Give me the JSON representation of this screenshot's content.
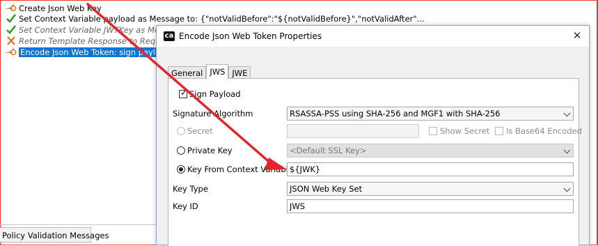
{
  "policy_tree": {
    "items": [
      {
        "label": "Create Json Web Key",
        "icon": "json-web-key-icon",
        "state": "normal"
      },
      {
        "label": "Set Context Variable payload as Message to: {\"notValidBefore\":\"${notValidBefore}\",\"notValidAfter\"...",
        "icon": "green-check-icon",
        "state": "normal"
      },
      {
        "label": "Set Context Variable JWTKey as Message",
        "icon": "green-check-icon",
        "state": "disabled"
      },
      {
        "label": "Return Template Response to Requestor",
        "icon": "red-x-icon",
        "state": "disabled"
      },
      {
        "label": "Encode Json Web Token: sign payload",
        "icon": "json-web-token-icon",
        "state": "selected"
      }
    ]
  },
  "bottom_tab": {
    "label": "Policy Validation Messages"
  },
  "dialog": {
    "title": "Encode Json Web Token Properties",
    "logo_text": "ca",
    "close_glyph": "✕",
    "tabs": [
      {
        "label": "General",
        "active": false
      },
      {
        "label": "JWS",
        "active": true
      },
      {
        "label": "JWE",
        "active": false
      }
    ],
    "sign_payload": {
      "label": "Sign Payload",
      "checked": true
    },
    "signature_algorithm": {
      "label": "Signature Algorithm",
      "value": "RSASSA-PSS using SHA-256 and MGF1 with SHA-256"
    },
    "secret": {
      "label": "Secret",
      "value": "",
      "enabled": false
    },
    "show_secret": {
      "label": "Show Secret",
      "checked": false
    },
    "is_base64": {
      "label": "Is Base64 Encoded",
      "checked": false
    },
    "private_key": {
      "label": "Private Key",
      "value": "<Default SSL Key>",
      "selected": false
    },
    "key_from_context": {
      "label": "Key From Context Variable",
      "value": "${JWK}",
      "selected": true
    },
    "key_type": {
      "label": "Key Type",
      "value": "JSON Web Key Set"
    },
    "key_id": {
      "label": "Key ID",
      "value": "JWS"
    }
  },
  "colors": {
    "selection": "#0f74d6",
    "annotation_arrow": "#e3262b",
    "check_green": "#2e9e2e"
  }
}
